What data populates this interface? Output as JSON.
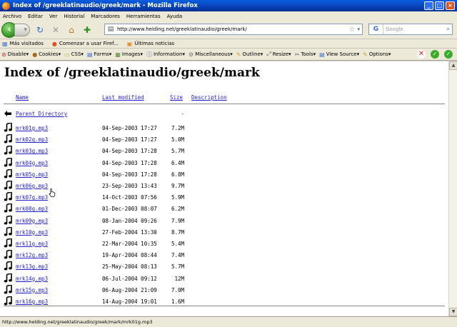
{
  "window": {
    "title": "Index of /greeklatinaudio/greek/mark - Mozilla Firefox"
  },
  "menu": [
    "Archivo",
    "Editar",
    "Ver",
    "Historial",
    "Marcadores",
    "Herramientas",
    "Ayuda"
  ],
  "navbar": {
    "url": "http://www.helding.net/greeklatinaudio/greek/mark/",
    "search_placeholder": "Google",
    "search_engine_icon": "G"
  },
  "bookmarks": [
    {
      "label": "Más visitados",
      "icon": "bookmark-icon"
    },
    {
      "label": "Comenzar a usar Firef...",
      "icon": "firefox-icon"
    },
    {
      "label": "Últimas noticias",
      "icon": "rss-icon"
    }
  ],
  "devbar": [
    {
      "label": "Disable▾",
      "icon": "disable-icon"
    },
    {
      "label": "Cookies▾",
      "icon": "cookie-icon"
    },
    {
      "label": "CSS▾",
      "icon": "css-icon"
    },
    {
      "label": "Forms▾",
      "icon": "forms-icon"
    },
    {
      "label": "Images▾",
      "icon": "images-icon"
    },
    {
      "label": "Information▾",
      "icon": "info-icon"
    },
    {
      "label": "Miscellaneous▾",
      "icon": "misc-icon"
    },
    {
      "label": "Outline▾",
      "icon": "outline-icon"
    },
    {
      "label": "Resize▾",
      "icon": "resize-icon"
    },
    {
      "label": "Tools▾",
      "icon": "tools-icon"
    },
    {
      "label": "View Source▾",
      "icon": "view-source-icon"
    },
    {
      "label": "Options▾",
      "icon": "options-icon"
    }
  ],
  "page": {
    "heading": "Index of /greeklatinaudio/greek/mark",
    "columns": {
      "name": "Name",
      "modified": "Last modified",
      "size": "Size",
      "description": "Description"
    },
    "parent": {
      "label": "Parent Directory",
      "size": "-"
    },
    "files": [
      {
        "name": "mrk01g.mp3",
        "date": "04-Sep-2003 17:27",
        "size": "7.2M"
      },
      {
        "name": "mrk02g.mp3",
        "date": "04-Sep-2003 17:27",
        "size": "5.0M"
      },
      {
        "name": "mrk03g.mp3",
        "date": "04-Sep-2003 17:28",
        "size": "5.7M"
      },
      {
        "name": "mrk04g.mp3",
        "date": "04-Sep-2003 17:28",
        "size": "6.4M"
      },
      {
        "name": "mrk05g.mp3",
        "date": "04-Sep-2003 17:28",
        "size": "6.8M"
      },
      {
        "name": "mrk06g.mp3",
        "date": "23-Sep-2003 13:43",
        "size": "9.7M"
      },
      {
        "name": "mrk07g.mp3",
        "date": "14-Oct-2003 07:56",
        "size": "5.9M"
      },
      {
        "name": "mrk08g.mp3",
        "date": "01-Dec-2003 08:07",
        "size": "6.2M"
      },
      {
        "name": "mrk09g.mp3",
        "date": "08-Jan-2004 09:26",
        "size": "7.9M"
      },
      {
        "name": "mrk10g.mp3",
        "date": "27-Feb-2004 13:30",
        "size": "8.7M"
      },
      {
        "name": "mrk11g.mp3",
        "date": "22-Mar-2004 10:35",
        "size": "5.4M"
      },
      {
        "name": "mrk12g.mp3",
        "date": "19-Apr-2004 08:44",
        "size": "7.4M"
      },
      {
        "name": "mrk13g.mp3",
        "date": "25-May-2004 08:13",
        "size": "5.7M"
      },
      {
        "name": "mrk14g.mp3",
        "date": "06-Jul-2004 09:12",
        "size": "12M"
      },
      {
        "name": "mrk15g.mp3",
        "date": "06-Aug-2004 21:09",
        "size": "7.0M"
      },
      {
        "name": "mrk16g.mp3",
        "date": "14-Aug-2004 19:01",
        "size": "1.6M"
      }
    ]
  },
  "status": {
    "text": "http://www.helding.net/greeklatinaudio/greek/mark/mrk01g.mp3"
  }
}
